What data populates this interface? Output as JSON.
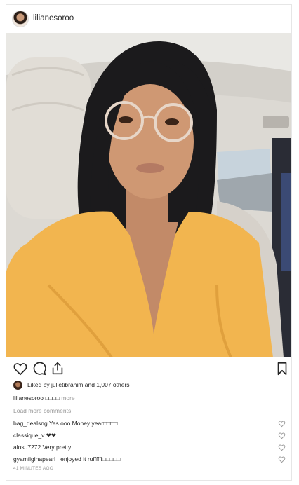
{
  "post": {
    "username": "lilianesoroo",
    "likes_text": "Liked by julietibrahim and 1,007 others",
    "caption_user": "lilianesoroo",
    "caption_text": "□□□□",
    "caption_more": "more",
    "load_more": "Load more comments",
    "comments": [
      {
        "text": "bag_dealsng Yes ooo Money year□□□□"
      },
      {
        "text": "classique_v ❤❤"
      },
      {
        "text": "alosu7272 Very pretty"
      },
      {
        "text": "gyamfiginapearl I enjoyed it ruffffff□□□□□"
      }
    ],
    "time": "41 MINUTES AGO"
  },
  "icons": {
    "like": "heart-icon",
    "comment": "comment-icon",
    "share": "share-icon",
    "save": "bookmark-icon"
  },
  "colors": {
    "text": "#262626",
    "muted": "#999999",
    "border": "#e6e6e6"
  }
}
